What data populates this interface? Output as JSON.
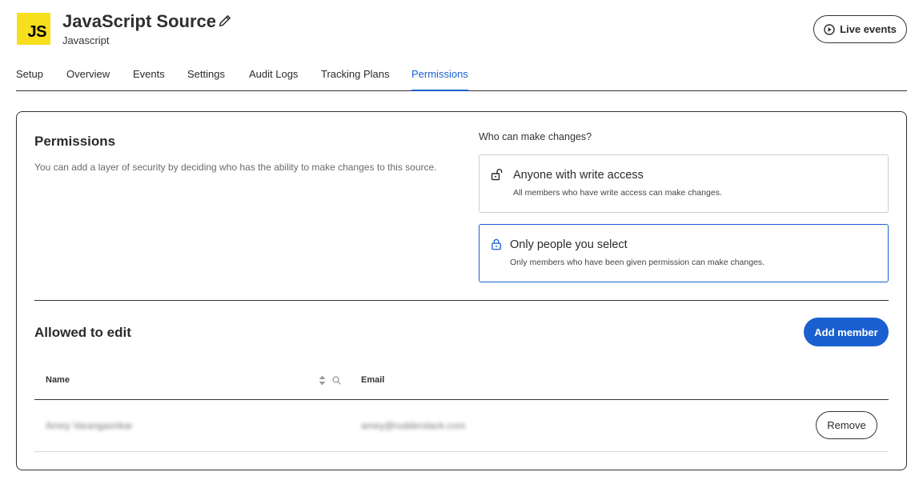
{
  "header": {
    "logo_text": "JS",
    "title": "JavaScript Source",
    "subtitle": "Javascript",
    "live_events_label": "Live events",
    "brand_color": "#f7df1e",
    "accent_color": "#1a5fd0"
  },
  "tabs": [
    {
      "label": "Setup",
      "active": false
    },
    {
      "label": "Overview",
      "active": false
    },
    {
      "label": "Events",
      "active": false
    },
    {
      "label": "Settings",
      "active": false
    },
    {
      "label": "Audit Logs",
      "active": false
    },
    {
      "label": "Tracking Plans",
      "active": false
    },
    {
      "label": "Permissions",
      "active": true
    }
  ],
  "permissions": {
    "title": "Permissions",
    "description": "You can add a layer of security by deciding who has the ability to make changes to this source.",
    "who_label": "Who can make changes?",
    "options": [
      {
        "title": "Anyone with write access",
        "description": "All members who have write access can make changes.",
        "icon": "unlock-icon",
        "selected": false
      },
      {
        "title": "Only people you select",
        "description": "Only members who have been given permission can make changes.",
        "icon": "lock-icon",
        "selected": true
      }
    ]
  },
  "allowed": {
    "title": "Allowed to edit",
    "add_member_label": "Add member",
    "columns": {
      "name": "Name",
      "email": "Email"
    },
    "rows": [
      {
        "name": "Amey Varangaonkar",
        "email": "amey@rudderstack.com",
        "remove_label": "Remove"
      }
    ]
  }
}
